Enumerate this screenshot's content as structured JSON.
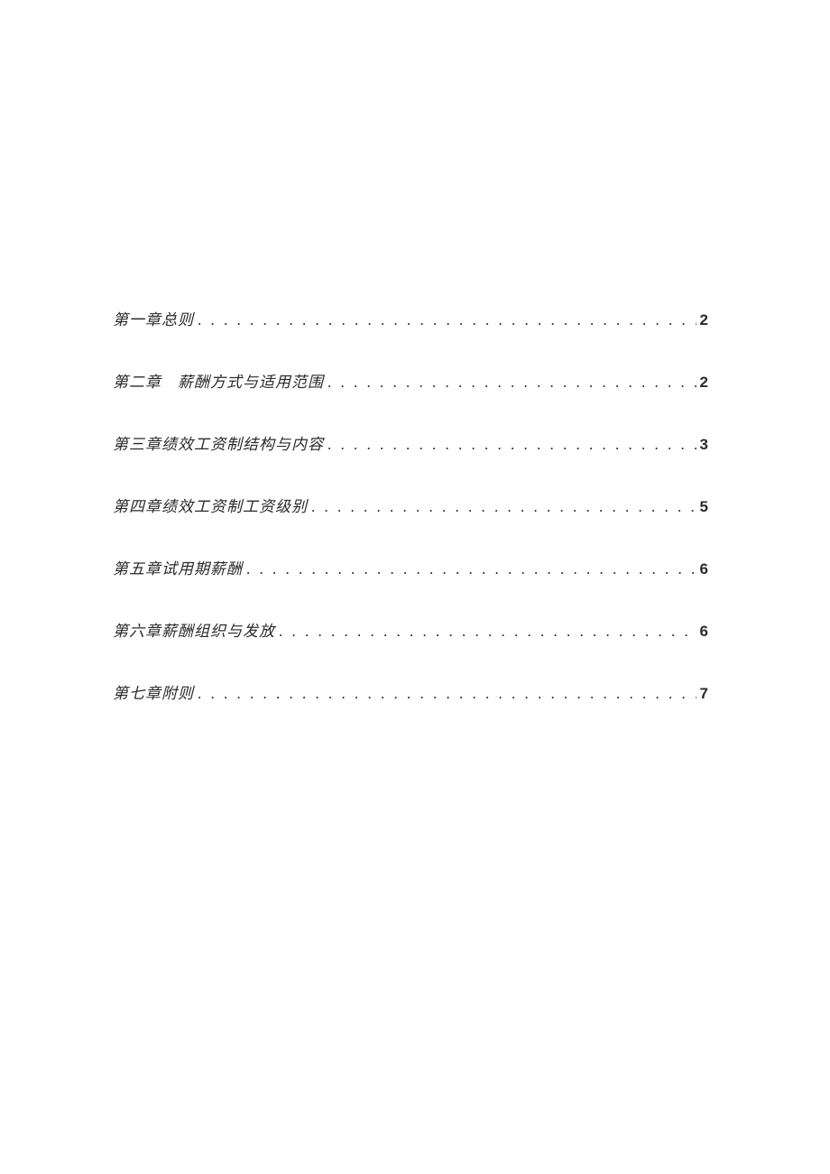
{
  "toc": [
    {
      "title": "第一章总则",
      "page": "2"
    },
    {
      "title": "第二章　薪酬方式与适用范围",
      "page": "2"
    },
    {
      "title": "第三章绩效工资制结构与内容",
      "page": "3"
    },
    {
      "title": "第四章绩效工资制工资级别",
      "page": "5"
    },
    {
      "title": "第五章试用期薪酬",
      "page": "6"
    },
    {
      "title": "第六章薪酬组织与发放",
      "page": "6"
    },
    {
      "title": "第七章附则",
      "page": "7"
    }
  ]
}
